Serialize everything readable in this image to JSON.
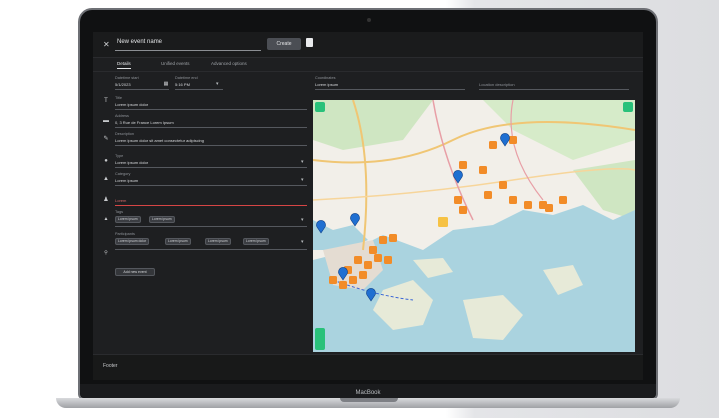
{
  "laptop": {
    "brand_label": "MacBook"
  },
  "topbar": {
    "close_icon": "close-icon",
    "name_value": "New event name",
    "save_label": "Create",
    "doc_icon": "document-icon"
  },
  "tabs": [
    {
      "label": "Details",
      "active": true
    },
    {
      "label": "Unified events",
      "active": false
    },
    {
      "label": "Advanced options",
      "active": false
    }
  ],
  "form": {
    "datetime": {
      "date_label": "Datetime start",
      "date_value": "5/1/2023",
      "time_label": "Datetime end",
      "time_value": "5:16 PM"
    },
    "title": {
      "label": "Title",
      "value": "Lorem ipsum dolor"
    },
    "address": {
      "label": "Address",
      "value": "0, 3 Rue de France Lorem Ipsum"
    },
    "description": {
      "label": "Description",
      "value": "Lorem ipsum dolor sit amet consectetur adipiscing"
    },
    "type": {
      "label": "Type",
      "value": "Lorem ipsum dolor"
    },
    "category": {
      "label": "Category",
      "value": "Lorem ipsum"
    },
    "required_label": "Lorem",
    "tags": {
      "label": "Tags",
      "chips": [
        "Lorem ipsum",
        "Lorem ipsum"
      ]
    },
    "participants": {
      "label": "Participants",
      "chips": [
        "Lorem ipsum dolor",
        "Lorem ipsum",
        "Lorem ipsum",
        "Lorem ipsum"
      ]
    },
    "add_button_label": "Add new event"
  },
  "coordinates": {
    "label": "Coordinates",
    "value": "Lorem ipsum"
  },
  "description_field": {
    "placeholder": "Location description"
  },
  "footer": {
    "label": "Footer"
  },
  "colors": {
    "marker_orange": "#f28c28",
    "marker_selected": "#f6c244",
    "pin_blue": "#1f6fd1",
    "accent_green": "#29c17a",
    "water": "#aad3df",
    "land": "#f2efe9",
    "road": "#f0c674"
  }
}
